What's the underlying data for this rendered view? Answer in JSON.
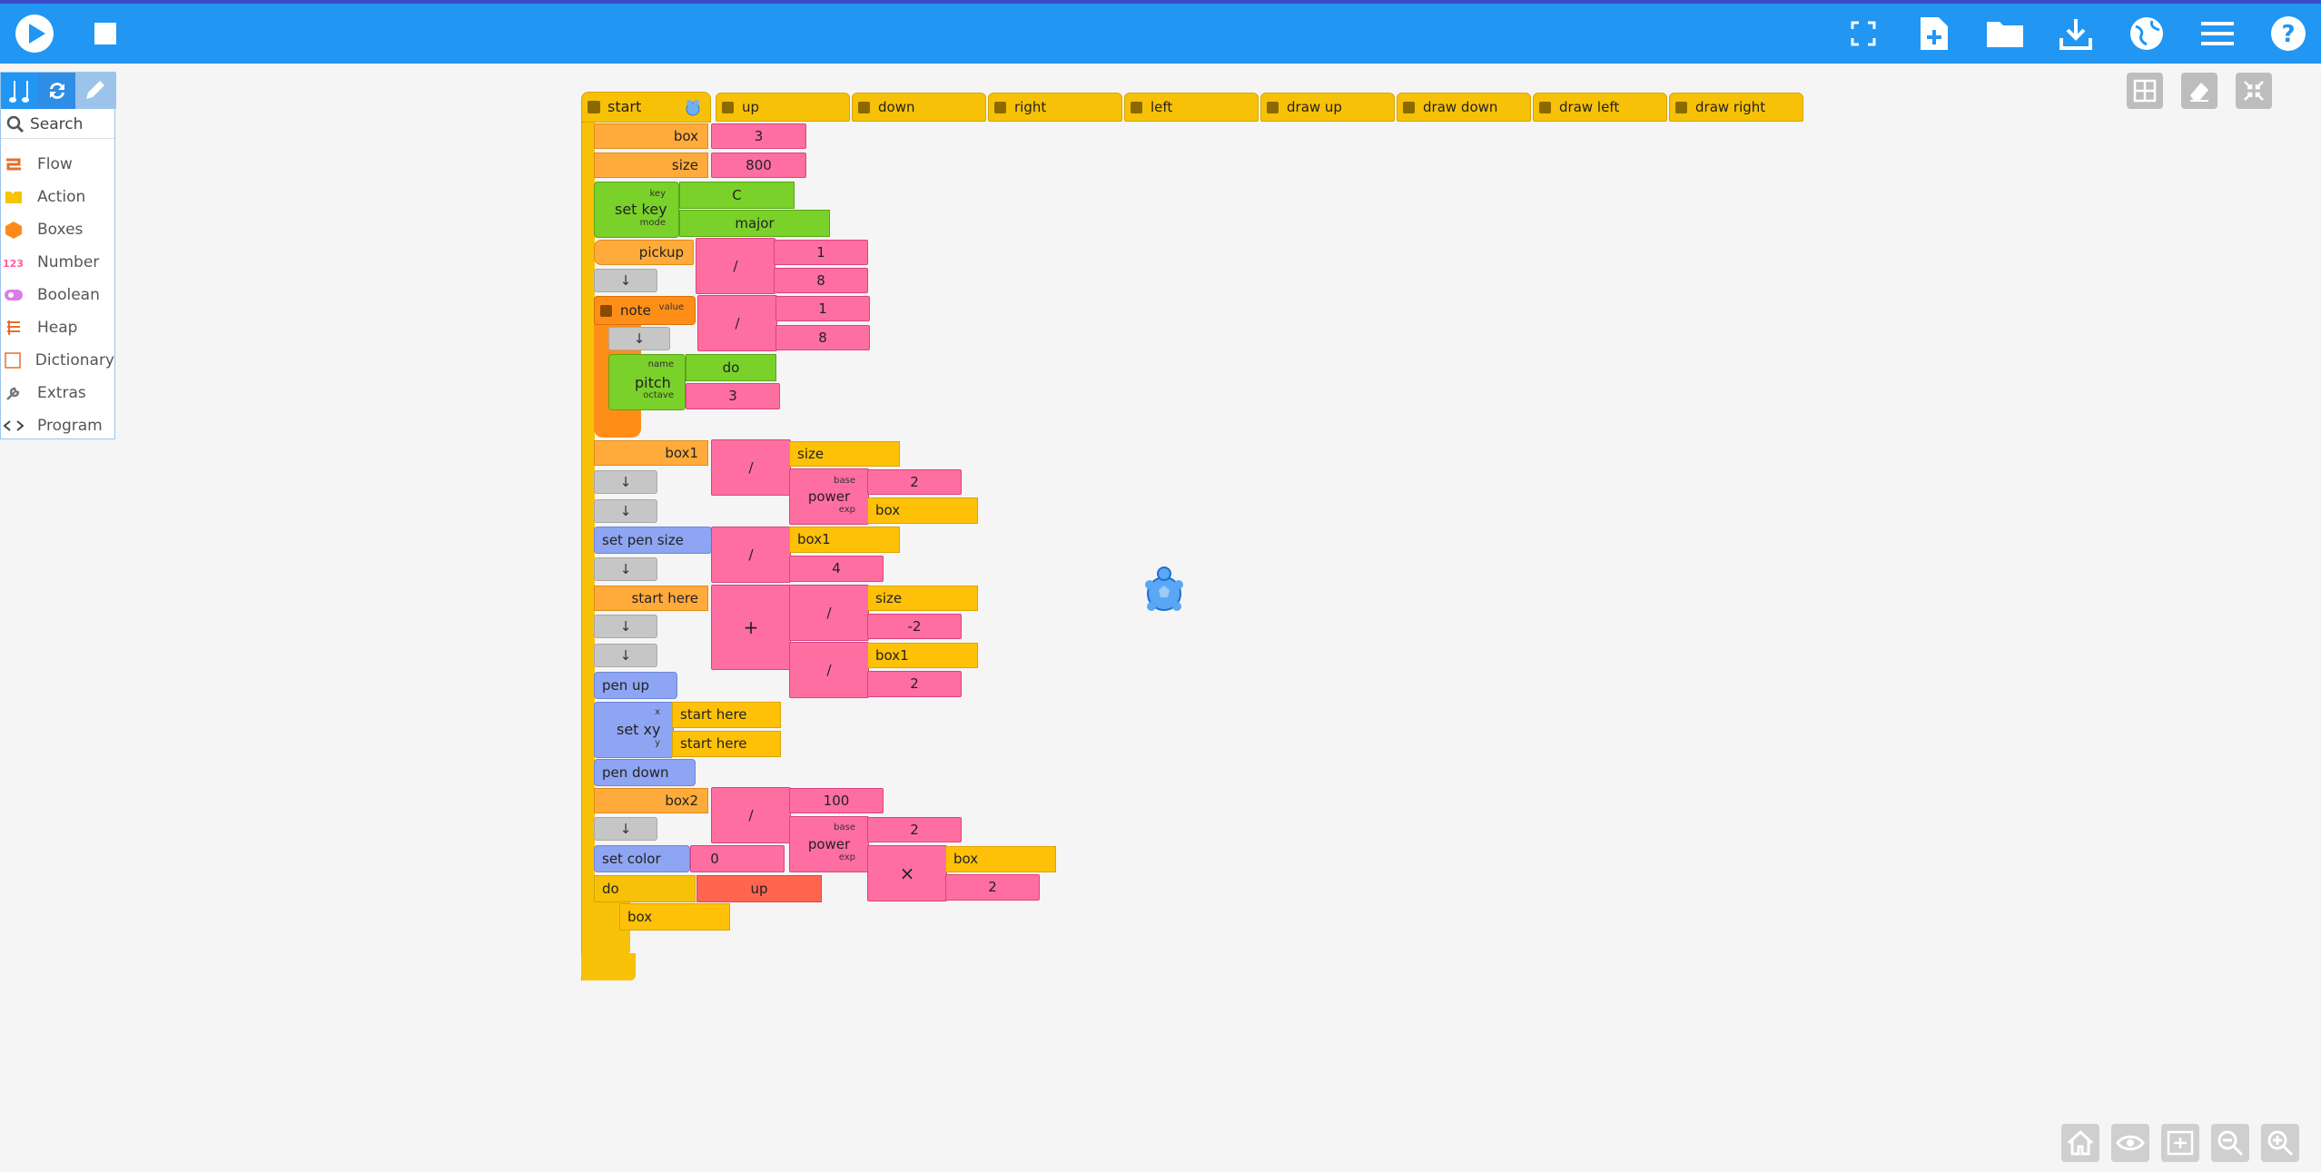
{
  "toolbar": {
    "left": [
      {
        "name": "play-icon"
      },
      {
        "name": "stop-icon"
      }
    ],
    "right": [
      {
        "name": "fullscreen-icon"
      },
      {
        "name": "new-file-icon"
      },
      {
        "name": "open-folder-icon"
      },
      {
        "name": "download-icon"
      },
      {
        "name": "globe-icon"
      },
      {
        "name": "menu-icon"
      },
      {
        "name": "help-icon"
      }
    ]
  },
  "palette": {
    "search_label": "Search",
    "items": [
      {
        "label": "Flow",
        "icon": "flow-icon",
        "color": "#e4702c"
      },
      {
        "label": "Action",
        "icon": "action-icon",
        "color": "#f6c400"
      },
      {
        "label": "Boxes",
        "icon": "boxes-icon",
        "color": "#ff8a1b"
      },
      {
        "label": "Number",
        "icon": "number-icon",
        "color": "#ff5aa0"
      },
      {
        "label": "Boolean",
        "icon": "boolean-icon",
        "color": "#d97ee6"
      },
      {
        "label": "Heap",
        "icon": "heap-icon",
        "color": "#e4702c"
      },
      {
        "label": "Dictionary",
        "icon": "dictionary-icon",
        "color": "#e4702c"
      },
      {
        "label": "Extras",
        "icon": "extras-icon",
        "color": "#777"
      },
      {
        "label": "Program",
        "icon": "program-icon",
        "color": "#444"
      }
    ]
  },
  "canvas": {
    "start_label": "start",
    "actions": [
      "up",
      "down",
      "right",
      "left",
      "draw up",
      "draw down",
      "draw left",
      "draw right"
    ],
    "blocks": {
      "box": "box",
      "box_val": "3",
      "size": "size",
      "size_val": "800",
      "set_key": "set key",
      "key_lbl": "key",
      "mode_lbl": "mode",
      "key_val": "C",
      "mode_val": "major",
      "pickup": "pickup",
      "pickup_num": "1",
      "pickup_den": "8",
      "arrow": "↓",
      "note": "note",
      "value_lbl": "value",
      "note_num": "1",
      "note_den": "8",
      "pitch": "pitch",
      "name_lbl": "name",
      "octave_lbl": "octave",
      "pitch_name": "do",
      "pitch_oct": "3",
      "box1": "box1",
      "div": "/",
      "size_ref": "size",
      "power": "power",
      "base_lbl": "base",
      "exp_lbl": "exp",
      "pow_base": "2",
      "box_ref": "box",
      "set_pen_size": "set pen size",
      "box1_ref": "box1",
      "pen_den": "4",
      "start_here": "start here",
      "plus": "+",
      "neg2": "-2",
      "two": "2",
      "pen_up": "pen up",
      "set_xy": "set xy",
      "x_lbl": "x",
      "y_lbl": "y",
      "start_here_ref": "start here",
      "pen_down": "pen down",
      "box2": "box2",
      "hundred": "100",
      "times": "×",
      "set_color": "set color",
      "zero": "0",
      "do": "do",
      "up_ref": "up"
    }
  },
  "canvas_controls": [
    {
      "name": "grid-icon"
    },
    {
      "name": "eraser-icon"
    },
    {
      "name": "collapse-icon"
    }
  ],
  "bottom_controls": [
    {
      "name": "home-icon"
    },
    {
      "name": "eye-icon"
    },
    {
      "name": "expand-icon"
    },
    {
      "name": "zoom-out-icon"
    },
    {
      "name": "zoom-in-icon"
    }
  ]
}
